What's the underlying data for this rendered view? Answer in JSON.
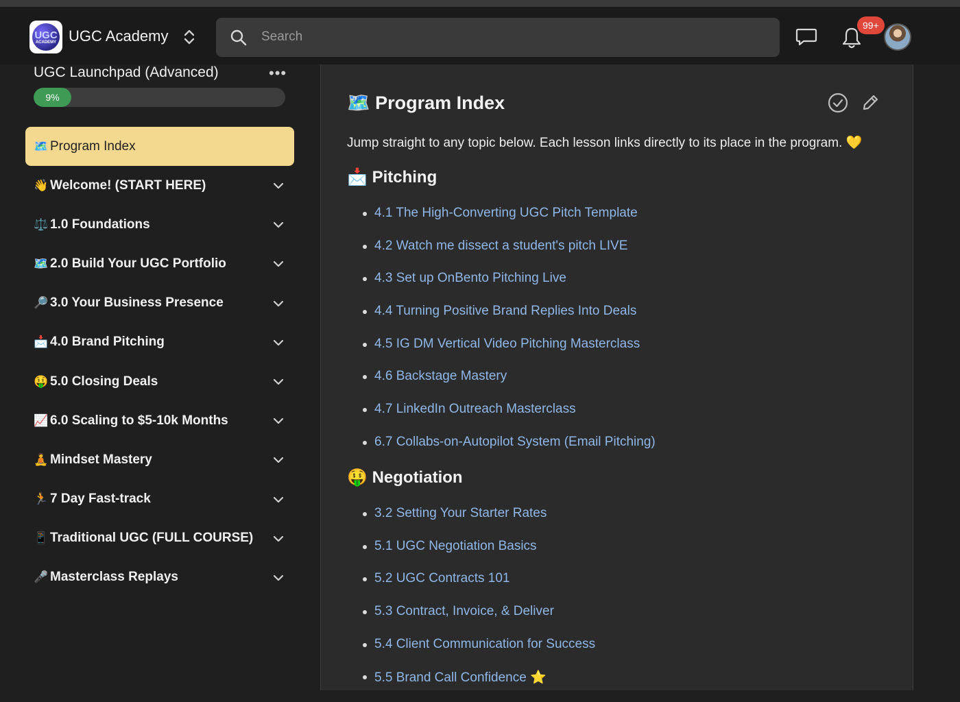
{
  "header": {
    "brand": "UGC Academy",
    "logo_text_top": "UGC",
    "logo_text_bottom": "ACADEMY",
    "search_placeholder": "Search",
    "notifications_count": "99+"
  },
  "sidebar": {
    "course_title": "UGC Launchpad (Advanced)",
    "progress_label": "9%",
    "progress_value": 0.09,
    "items": [
      {
        "emoji": "🗺️",
        "label": "Program Index",
        "active": true
      },
      {
        "emoji": "👋",
        "label": "Welcome! (START HERE)"
      },
      {
        "emoji": "⚖️",
        "label": "1.0 Foundations"
      },
      {
        "emoji": "🗺️",
        "label": "2.0 Build Your UGC Portfolio"
      },
      {
        "emoji": "🔎",
        "label": "3.0 Your Business Presence"
      },
      {
        "emoji": "📩",
        "label": "4.0 Brand Pitching"
      },
      {
        "emoji": "🤑",
        "label": "5.0 Closing Deals"
      },
      {
        "emoji": "📈",
        "label": "6.0 Scaling to $5-10k Months"
      },
      {
        "emoji": "🧘",
        "label": "Mindset Mastery"
      },
      {
        "emoji": "🏃",
        "label": "7 Day Fast-track"
      },
      {
        "emoji": "📱",
        "label": "Traditional UGC (FULL COURSE)"
      },
      {
        "emoji": "🎤",
        "label": "Masterclass Replays"
      }
    ]
  },
  "main": {
    "title_emoji": "🗺️",
    "title": "Program Index",
    "intro": "Jump straight to any topic below. Each lesson links directly to its place in the program. 💛",
    "sections": [
      {
        "emoji": "📩",
        "heading": "Pitching",
        "links": [
          "4.1 The High-Converting UGC Pitch Template",
          "4.2 Watch me dissect a student's pitch LIVE",
          "4.3 Set up OnBento Pitching Live",
          "4.4 Turning Positive Brand Replies Into Deals",
          "4.5 IG DM Vertical Video Pitching Masterclass",
          "4.6 Backstage Mastery",
          "4.7 LinkedIn Outreach Masterclass",
          "6.7 Collabs-on-Autopilot System (Email Pitching)"
        ]
      },
      {
        "emoji": "🤑",
        "heading": "Negotiation",
        "links": [
          "3.2 Setting Your Starter Rates",
          "5.1 UGC Negotiation Basics",
          "5.2 UGC Contracts 101",
          "5.3 Contract, Invoice, & Deliver",
          "5.4 Client Communication for Success",
          "5.5 Brand Call Confidence ⭐"
        ]
      }
    ]
  },
  "colors": {
    "active_item_bg": "#f2d98f",
    "progress_fill": "#3f9a55",
    "link": "#8fb7e8",
    "badge": "#e0473b"
  }
}
